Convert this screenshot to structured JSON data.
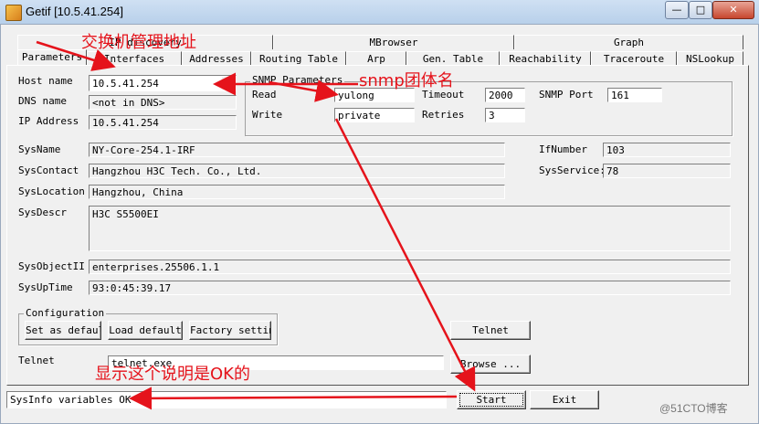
{
  "window": {
    "title": "Getif [10.5.41.254]",
    "min": "—",
    "max": "□",
    "close": "✕"
  },
  "tabs_row1": [
    "IP discovery",
    "MBrowser",
    "Graph"
  ],
  "tabs_row2": [
    "Parameters",
    "Interfaces",
    "Addresses",
    "Routing Table",
    "Arp",
    "Gen. Table",
    "Reachability",
    "Traceroute",
    "NSLookup"
  ],
  "host": {
    "host_label": "Host name",
    "host_value": "10.5.41.254",
    "dns_label": "DNS name",
    "dns_value": "<not in DNS>",
    "ip_label": "IP Address",
    "ip_value": "10.5.41.254"
  },
  "snmp": {
    "title": "SNMP Parameters",
    "read_label": "Read",
    "read_value": "yulong",
    "write_label": "Write",
    "write_value": "private",
    "timeout_label": "Timeout",
    "timeout_value": "2000",
    "retries_label": "Retries",
    "retries_value": "3",
    "port_label": "SNMP Port",
    "port_value": "161"
  },
  "sys": {
    "name_label": "SysName",
    "name_value": "NY-Core-254.1-IRF",
    "contact_label": "SysContact",
    "contact_value": "Hangzhou H3C Tech. Co., Ltd.",
    "location_label": "SysLocation",
    "location_value": "Hangzhou, China",
    "descr_label": "SysDescr",
    "descr_value": "H3C S5500EI",
    "objectid_label": "SysObjectII",
    "objectid_value": "enterprises.25506.1.1",
    "uptime_label": "SysUpTime",
    "uptime_value": "93:0:45:39.17",
    "ifnumber_label": "IfNumber",
    "ifnumber_value": "103",
    "services_label": "SysService:",
    "services_value": "78"
  },
  "config": {
    "title": "Configuration",
    "set_default": "Set as default",
    "load_default": "Load default",
    "factory": "Factory setting"
  },
  "telnet": {
    "button": "Telnet",
    "label": "Telnet",
    "path": "telnet.exe",
    "browse": "Browse ..."
  },
  "status": {
    "text": "SysInfo variables OK",
    "start": "Start",
    "exit": "Exit"
  },
  "annotations": {
    "switch_ip": "交换机管理地址",
    "community": "snmp团体名",
    "ok_note": "显示这个说明是OK的"
  },
  "watermark": "@51CTO博客",
  "colors": {
    "annotation": "#e5131b"
  }
}
